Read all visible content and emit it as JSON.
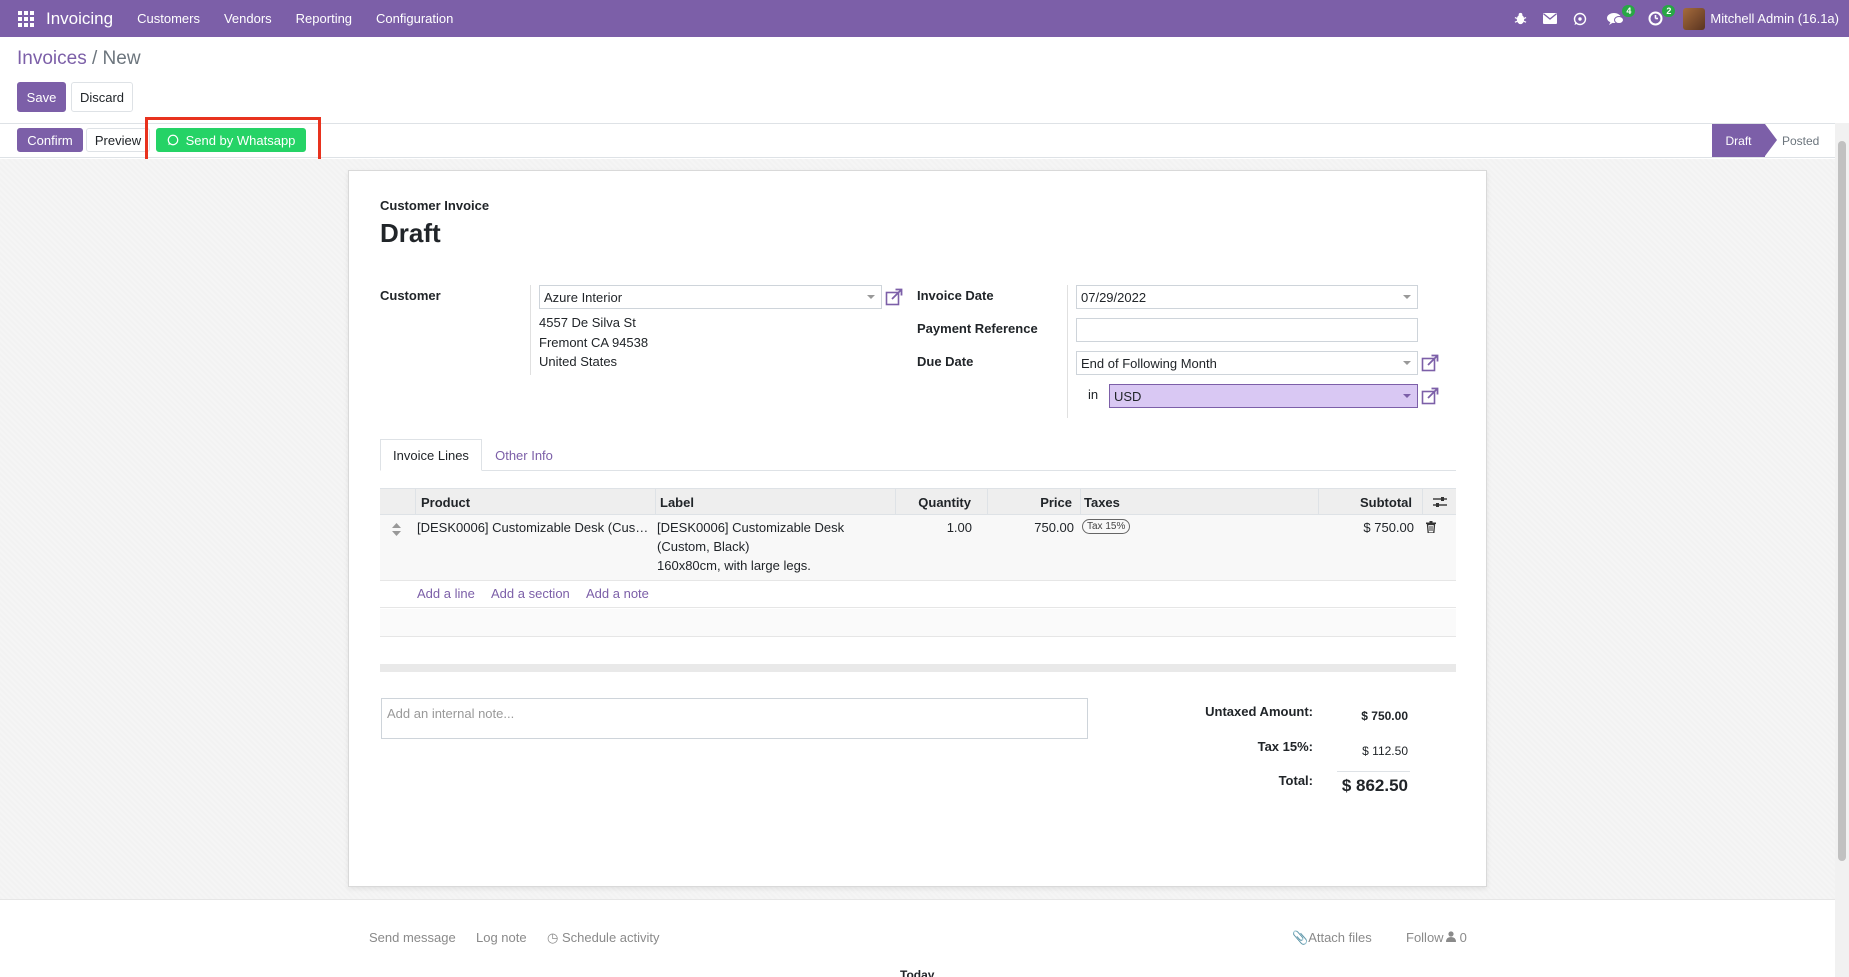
{
  "navbar": {
    "brand": "Invoicing",
    "menu": [
      "Customers",
      "Vendors",
      "Reporting",
      "Configuration"
    ],
    "chat_badge": "4",
    "activity_badge": "2",
    "user": "Mitchell Admin (16.1a)"
  },
  "breadcrumb": {
    "parent": "Invoices",
    "separator": "/",
    "current": "New"
  },
  "control": {
    "save": "Save",
    "discard": "Discard"
  },
  "actions": {
    "confirm": "Confirm",
    "preview": "Preview",
    "whatsapp": "Send by Whatsapp"
  },
  "status": {
    "draft": "Draft",
    "posted": "Posted"
  },
  "invoice": {
    "type_label": "Customer Invoice",
    "title": "Draft",
    "customer_label": "Customer",
    "customer": "Azure Interior",
    "address": [
      "4557 De Silva St",
      "Fremont CA 94538",
      "United States"
    ],
    "invoice_date_label": "Invoice Date",
    "invoice_date": "07/29/2022",
    "payment_ref_label": "Payment Reference",
    "payment_ref": "",
    "due_date_label": "Due Date",
    "due_date": "End of Following Month",
    "in_label": "in",
    "currency": "USD"
  },
  "tabs": {
    "lines": "Invoice Lines",
    "other": "Other Info"
  },
  "table": {
    "headers": {
      "product": "Product",
      "label": "Label",
      "quantity": "Quantity",
      "price": "Price",
      "taxes": "Taxes",
      "subtotal": "Subtotal"
    },
    "row": {
      "product": "[DESK0006] Customizable Desk (Cus…",
      "label": [
        "[DESK0006] Customizable Desk",
        "(Custom, Black)",
        "160x80cm, with large legs."
      ],
      "quantity": "1.00",
      "price": "750.00",
      "tax": "Tax 15%",
      "subtotal": "$ 750.00"
    },
    "add_line": "Add a line",
    "add_section": "Add a section",
    "add_note": "Add a note"
  },
  "note_placeholder": "Add an internal note...",
  "totals": {
    "untaxed_label": "Untaxed Amount:",
    "untaxed": "$ 750.00",
    "tax_label": "Tax 15%:",
    "tax": "$ 112.50",
    "total_label": "Total:",
    "total": "$ 862.50"
  },
  "chatter": {
    "send_message": "Send message",
    "log_note": "Log note",
    "schedule": "Schedule activity",
    "attach": "Attach files",
    "follow": "Follow",
    "followers": "0",
    "today": "Today"
  },
  "colors": {
    "brand": "#7c5fa8",
    "whatsapp": "#25d366",
    "highlight": "#e8321e",
    "currency_bg": "#d9c8f3"
  }
}
